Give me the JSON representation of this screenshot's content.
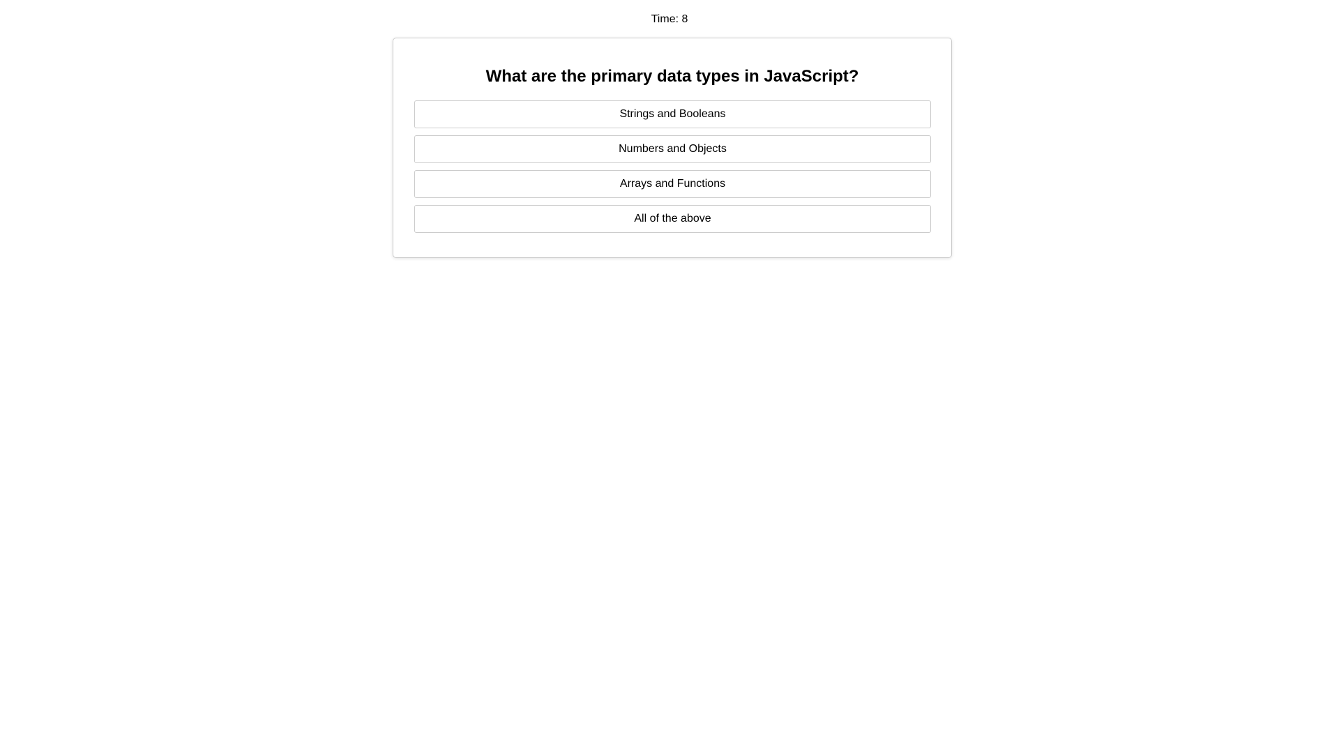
{
  "timer": {
    "label": "Time: 8"
  },
  "quiz": {
    "question": "What are the primary data types in JavaScript?",
    "answers": [
      {
        "label": "Strings and Booleans"
      },
      {
        "label": "Numbers and Objects"
      },
      {
        "label": "Arrays and Functions"
      },
      {
        "label": "All of the above"
      }
    ]
  }
}
